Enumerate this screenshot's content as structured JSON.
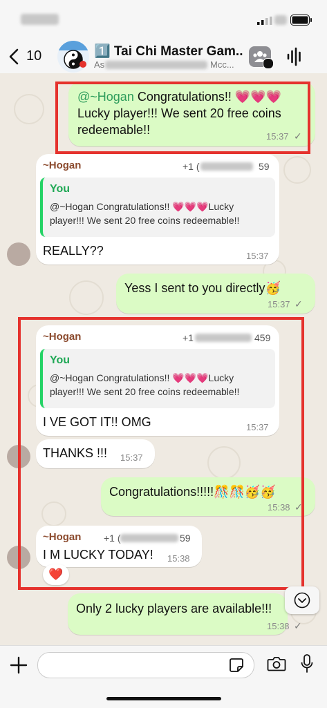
{
  "status_bar": {},
  "header": {
    "back_label": "10",
    "group_name": "1️⃣ Tai Chi Master Gam...",
    "group_subtitle_visible": "As",
    "group_subtitle_end": "Mcc..."
  },
  "messages": [
    {
      "id": "m1",
      "direction": "out",
      "mention": "@~Hogan",
      "text": " Congratulations!! 💗💗💗 Lucky player!!! We sent 20 free coins redeemable!!",
      "time": "15:37",
      "tick": "✓"
    },
    {
      "id": "m2",
      "direction": "in",
      "sender": "~Hogan",
      "phone_prefix": "+1 (",
      "phone_suffix": "59",
      "quote_author": "You",
      "quote_text": "@~Hogan Congratulations!! 💗💗💗Lucky player!!! We sent 20 free coins redeemable!!",
      "text": "REALLY??",
      "time": "15:37"
    },
    {
      "id": "m3",
      "direction": "out",
      "text": "Yess I sent to you directly🥳",
      "time": "15:37",
      "tick": "✓"
    },
    {
      "id": "m4",
      "direction": "in",
      "sender": "~Hogan",
      "phone_prefix": "+1",
      "phone_suffix": "459",
      "quote_author": "You",
      "quote_text": "@~Hogan Congratulations!! 💗💗💗Lucky player!!! We sent 20 free coins redeemable!!",
      "text": "I VE GOT IT!! OMG",
      "time": "15:37"
    },
    {
      "id": "m5",
      "direction": "in",
      "text": "THANKS !!!",
      "time": "15:37"
    },
    {
      "id": "m6",
      "direction": "out",
      "text": "Congratulations!!!!!🎊🎊🥳🥳",
      "time": "15:38",
      "tick": "✓"
    },
    {
      "id": "m7",
      "direction": "in",
      "sender": "~Hogan",
      "phone_prefix": "+1 (",
      "phone_suffix": "59",
      "text": "I M LUCKY TODAY!",
      "time": "15:38",
      "reaction": "❤️"
    },
    {
      "id": "m8",
      "direction": "out",
      "text": "Only 2 lucky players are available!!!",
      "time": "15:38",
      "tick": "✓"
    }
  ],
  "icons": {
    "back": "chevron-left-icon",
    "group_avatar": "group-avatar",
    "group_info": "group-icon",
    "audio_call": "voice-waveform-icon",
    "scroll_down": "chevron-down-circle-icon",
    "plus": "plus-icon",
    "sticker": "sticker-icon",
    "camera": "camera-icon",
    "mic": "microphone-icon"
  },
  "colors": {
    "incoming_bubble": "#ffffff",
    "outgoing_bubble": "#dbfbc5",
    "highlight_box": "#e5322d",
    "chat_background": "#efeae2",
    "accent_green": "#25d366",
    "sender_name": "#8b4a2d"
  }
}
